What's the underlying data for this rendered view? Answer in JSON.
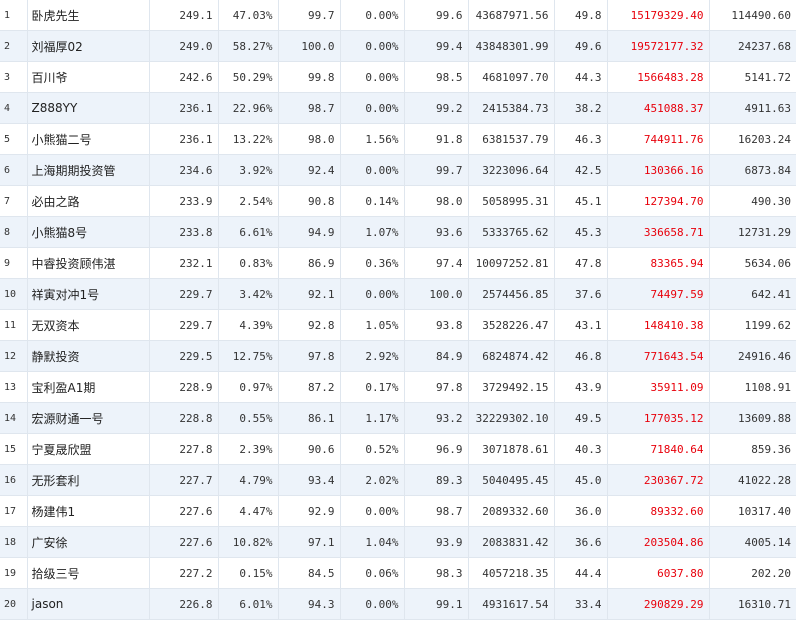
{
  "colors": {
    "highlight_value": "#e8000b",
    "row_alt_bg": "#edf3fa",
    "grid_line": "#dfe6ee"
  },
  "rows": [
    {
      "rank": "1",
      "name": "卧虎先生",
      "c1": "249.1",
      "c2": "47.03%",
      "c3": "99.7",
      "c4": "0.00%",
      "c5": "99.6",
      "c6": "43687971.56",
      "c7": "49.8",
      "c8": "15179329.40",
      "c9": "114490.60"
    },
    {
      "rank": "2",
      "name": "刘福厚02",
      "c1": "249.0",
      "c2": "58.27%",
      "c3": "100.0",
      "c4": "0.00%",
      "c5": "99.4",
      "c6": "43848301.99",
      "c7": "49.6",
      "c8": "19572177.32",
      "c9": "24237.68"
    },
    {
      "rank": "3",
      "name": "百川爷",
      "c1": "242.6",
      "c2": "50.29%",
      "c3": "99.8",
      "c4": "0.00%",
      "c5": "98.5",
      "c6": "4681097.70",
      "c7": "44.3",
      "c8": "1566483.28",
      "c9": "5141.72"
    },
    {
      "rank": "4",
      "name": "Z888YY",
      "c1": "236.1",
      "c2": "22.96%",
      "c3": "98.7",
      "c4": "0.00%",
      "c5": "99.2",
      "c6": "2415384.73",
      "c7": "38.2",
      "c8": "451088.37",
      "c9": "4911.63"
    },
    {
      "rank": "5",
      "name": "小熊猫二号",
      "c1": "236.1",
      "c2": "13.22%",
      "c3": "98.0",
      "c4": "1.56%",
      "c5": "91.8",
      "c6": "6381537.79",
      "c7": "46.3",
      "c8": "744911.76",
      "c9": "16203.24"
    },
    {
      "rank": "6",
      "name": "上海期期投资管",
      "c1": "234.6",
      "c2": "3.92%",
      "c3": "92.4",
      "c4": "0.00%",
      "c5": "99.7",
      "c6": "3223096.64",
      "c7": "42.5",
      "c8": "130366.16",
      "c9": "6873.84"
    },
    {
      "rank": "7",
      "name": "必由之路",
      "c1": "233.9",
      "c2": "2.54%",
      "c3": "90.8",
      "c4": "0.14%",
      "c5": "98.0",
      "c6": "5058995.31",
      "c7": "45.1",
      "c8": "127394.70",
      "c9": "490.30"
    },
    {
      "rank": "8",
      "name": "小熊猫8号",
      "c1": "233.8",
      "c2": "6.61%",
      "c3": "94.9",
      "c4": "1.07%",
      "c5": "93.6",
      "c6": "5333765.62",
      "c7": "45.3",
      "c8": "336658.71",
      "c9": "12731.29"
    },
    {
      "rank": "9",
      "name": "中睿投资顾伟湛",
      "c1": "232.1",
      "c2": "0.83%",
      "c3": "86.9",
      "c4": "0.36%",
      "c5": "97.4",
      "c6": "10097252.81",
      "c7": "47.8",
      "c8": "83365.94",
      "c9": "5634.06"
    },
    {
      "rank": "10",
      "name": "祥寅对冲1号",
      "c1": "229.7",
      "c2": "3.42%",
      "c3": "92.1",
      "c4": "0.00%",
      "c5": "100.0",
      "c6": "2574456.85",
      "c7": "37.6",
      "c8": "74497.59",
      "c9": "642.41"
    },
    {
      "rank": "11",
      "name": "无双资本",
      "c1": "229.7",
      "c2": "4.39%",
      "c3": "92.8",
      "c4": "1.05%",
      "c5": "93.8",
      "c6": "3528226.47",
      "c7": "43.1",
      "c8": "148410.38",
      "c9": "1199.62"
    },
    {
      "rank": "12",
      "name": "静默投资",
      "c1": "229.5",
      "c2": "12.75%",
      "c3": "97.8",
      "c4": "2.92%",
      "c5": "84.9",
      "c6": "6824874.42",
      "c7": "46.8",
      "c8": "771643.54",
      "c9": "24916.46"
    },
    {
      "rank": "13",
      "name": "宝利盈A1期",
      "c1": "228.9",
      "c2": "0.97%",
      "c3": "87.2",
      "c4": "0.17%",
      "c5": "97.8",
      "c6": "3729492.15",
      "c7": "43.9",
      "c8": "35911.09",
      "c9": "1108.91"
    },
    {
      "rank": "14",
      "name": "宏源财通一号",
      "c1": "228.8",
      "c2": "0.55%",
      "c3": "86.1",
      "c4": "1.17%",
      "c5": "93.2",
      "c6": "32229302.10",
      "c7": "49.5",
      "c8": "177035.12",
      "c9": "13609.88"
    },
    {
      "rank": "15",
      "name": "宁夏晟欣盟",
      "c1": "227.8",
      "c2": "2.39%",
      "c3": "90.6",
      "c4": "0.52%",
      "c5": "96.9",
      "c6": "3071878.61",
      "c7": "40.3",
      "c8": "71840.64",
      "c9": "859.36"
    },
    {
      "rank": "16",
      "name": "无形套利",
      "c1": "227.7",
      "c2": "4.79%",
      "c3": "93.4",
      "c4": "2.02%",
      "c5": "89.3",
      "c6": "5040495.45",
      "c7": "45.0",
      "c8": "230367.72",
      "c9": "41022.28"
    },
    {
      "rank": "17",
      "name": "杨建伟1",
      "c1": "227.6",
      "c2": "4.47%",
      "c3": "92.9",
      "c4": "0.00%",
      "c5": "98.7",
      "c6": "2089332.60",
      "c7": "36.0",
      "c8": "89332.60",
      "c9": "10317.40"
    },
    {
      "rank": "18",
      "name": "广安徐",
      "c1": "227.6",
      "c2": "10.82%",
      "c3": "97.1",
      "c4": "1.04%",
      "c5": "93.9",
      "c6": "2083831.42",
      "c7": "36.6",
      "c8": "203504.86",
      "c9": "4005.14"
    },
    {
      "rank": "19",
      "name": "拾级三号",
      "c1": "227.2",
      "c2": "0.15%",
      "c3": "84.5",
      "c4": "0.06%",
      "c5": "98.3",
      "c6": "4057218.35",
      "c7": "44.4",
      "c8": "6037.80",
      "c9": "202.20"
    },
    {
      "rank": "20",
      "name": "jason",
      "c1": "226.8",
      "c2": "6.01%",
      "c3": "94.3",
      "c4": "0.00%",
      "c5": "99.1",
      "c6": "4931617.54",
      "c7": "33.4",
      "c8": "290829.29",
      "c9": "16310.71"
    }
  ]
}
